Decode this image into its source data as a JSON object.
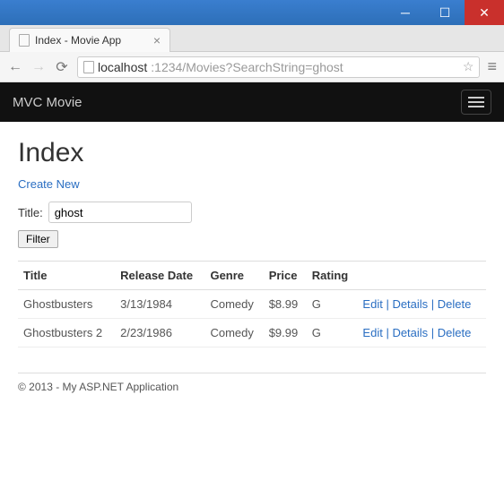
{
  "window": {
    "tab_title": "Index - Movie App"
  },
  "browser": {
    "url_host": "localhost",
    "url_path": ":1234/Movies?SearchString=ghost"
  },
  "navbar": {
    "brand": "MVC Movie"
  },
  "page": {
    "heading": "Index",
    "create_label": "Create New",
    "title_label": "Title:",
    "search_value": "ghost",
    "filter_label": "Filter"
  },
  "table": {
    "headers": {
      "title": "Title",
      "release": "Release Date",
      "genre": "Genre",
      "price": "Price",
      "rating": "Rating"
    },
    "rows": [
      {
        "title": "Ghostbusters",
        "release": "3/13/1984",
        "genre": "Comedy",
        "price": "$8.99",
        "rating": "G"
      },
      {
        "title": "Ghostbusters 2",
        "release": "2/23/1986",
        "genre": "Comedy",
        "price": "$9.99",
        "rating": "G"
      }
    ],
    "actions": {
      "edit": "Edit",
      "details": "Details",
      "delete": "Delete"
    }
  },
  "footer": {
    "text": "© 2013 - My ASP.NET Application"
  }
}
